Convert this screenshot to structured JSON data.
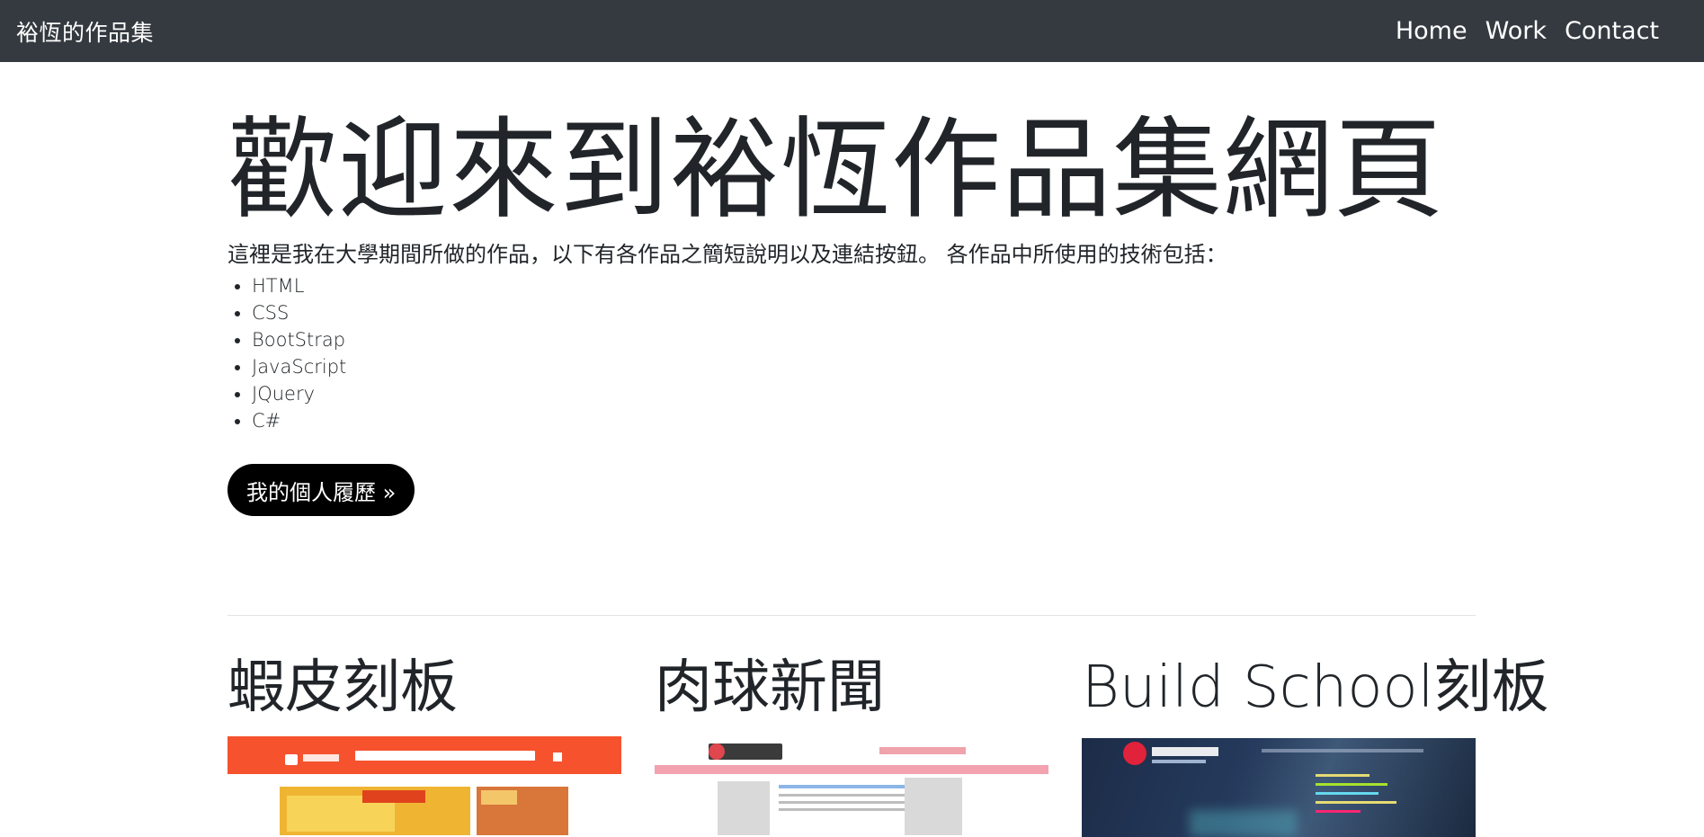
{
  "navbar": {
    "brand": "裕恆的作品集",
    "links": [
      "Home",
      "Work",
      "Contact"
    ]
  },
  "hero": {
    "title": "歡迎來到裕恆作品集網頁",
    "intro": "這裡是我在大學期間所做的作品，以下有各作品之簡短說明以及連結按鈕。 各作品中所使用的技術包括：",
    "technologies": [
      "HTML",
      "CSS",
      "BootStrap",
      "JavaScript",
      "JQuery",
      "C#"
    ],
    "cv_button": "我的個人履歷 »"
  },
  "works": [
    {
      "title": "蝦皮刻板",
      "thumb": "shopee-screenshot"
    },
    {
      "title": "肉球新聞",
      "thumb": "meatball-news-screenshot"
    },
    {
      "title": "Build School刻板",
      "thumb": "build-school-screenshot"
    }
  ],
  "colors": {
    "navbar_bg": "#343a40",
    "button_bg": "#000000",
    "shopee_orange": "#f6522e",
    "news_pink": "#f3a2b0"
  }
}
